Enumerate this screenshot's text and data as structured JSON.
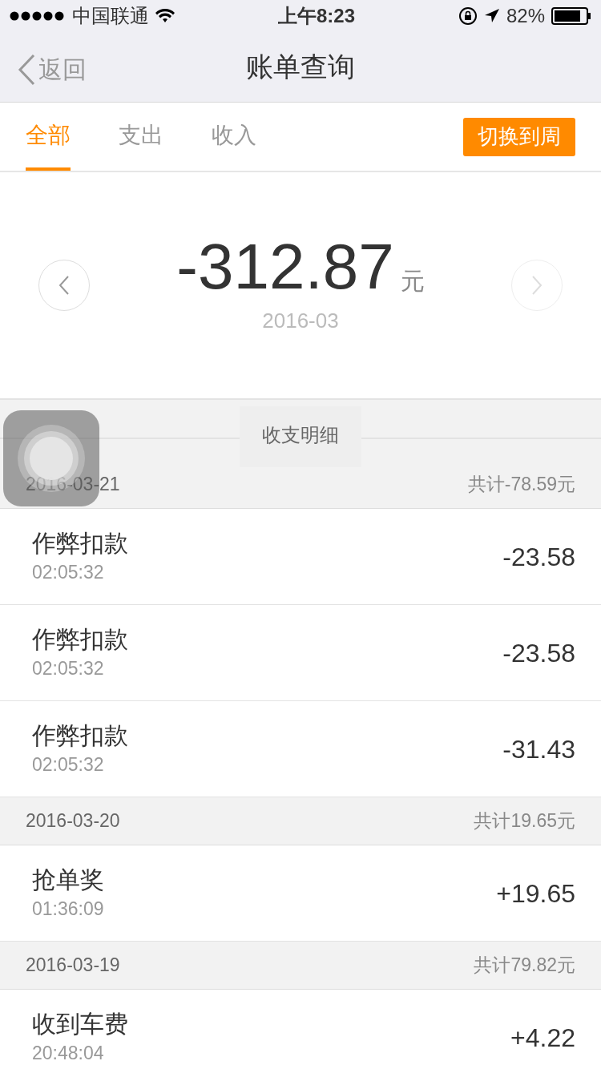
{
  "status_bar": {
    "carrier": "中国联通",
    "time": "上午8:23",
    "battery": "82%"
  },
  "nav": {
    "back": "返回",
    "title": "账单查询"
  },
  "tabs": [
    {
      "label": "全部",
      "selected": true
    },
    {
      "label": "支出",
      "selected": false
    },
    {
      "label": "收入",
      "selected": false
    }
  ],
  "switch_button": "切换到周",
  "summary": {
    "amount": "-312.87",
    "unit": "元",
    "period": "2016-03",
    "prev": {
      "disabled": false
    },
    "next": {
      "disabled": true
    }
  },
  "detail_header": "收支明细",
  "groups": [
    {
      "date": "2016-03-21",
      "total": "共计-78.59元",
      "items": [
        {
          "title": "作弊扣款",
          "time": "02:05:32",
          "amount": "-23.58"
        },
        {
          "title": "作弊扣款",
          "time": "02:05:32",
          "amount": "-23.58"
        },
        {
          "title": "作弊扣款",
          "time": "02:05:32",
          "amount": "-31.43"
        }
      ]
    },
    {
      "date": "2016-03-20",
      "total": "共计19.65元",
      "items": [
        {
          "title": "抢单奖",
          "time": "01:36:09",
          "amount": "+19.65"
        }
      ]
    },
    {
      "date": "2016-03-19",
      "total": "共计79.82元",
      "items": [
        {
          "title": "收到车费",
          "time": "20:48:04",
          "amount": "+4.22"
        }
      ]
    }
  ]
}
